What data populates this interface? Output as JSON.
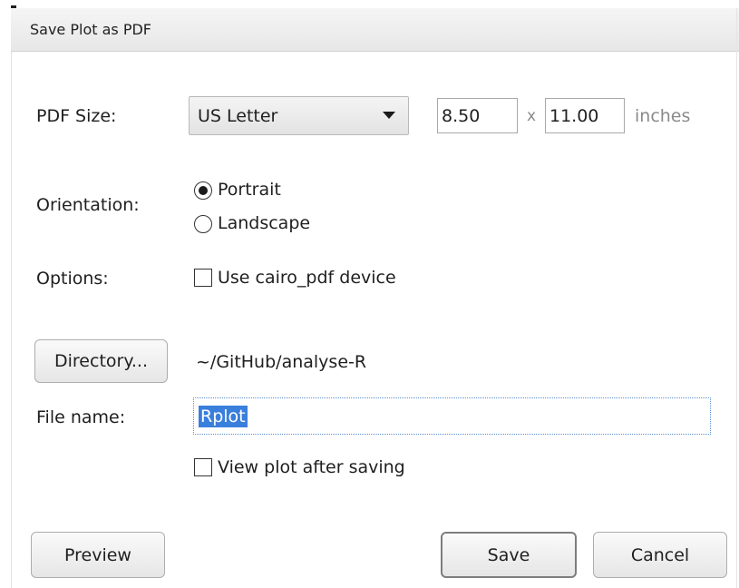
{
  "window": {
    "title": "Save Plot as PDF"
  },
  "pdf_size": {
    "label": "PDF Size:",
    "selected": "US Letter",
    "width": "8.50",
    "separator": "x",
    "height": "11.00",
    "unit": "inches"
  },
  "orientation": {
    "label": "Orientation:",
    "options": [
      {
        "label": "Portrait",
        "checked": true
      },
      {
        "label": "Landscape",
        "checked": false
      }
    ]
  },
  "options": {
    "label": "Options:",
    "cairo_label": "Use cairo_pdf device",
    "cairo_checked": false
  },
  "directory": {
    "button_label": "Directory...",
    "path": "~/GitHub/analyse-R"
  },
  "file": {
    "label": "File name:",
    "value": "Rplot"
  },
  "view_after": {
    "label": "View plot after saving",
    "checked": false
  },
  "buttons": {
    "preview": "Preview",
    "save": "Save",
    "cancel": "Cancel"
  },
  "colors": {
    "selection": "#3a7fdc",
    "muted_text": "#8a8a8a"
  }
}
